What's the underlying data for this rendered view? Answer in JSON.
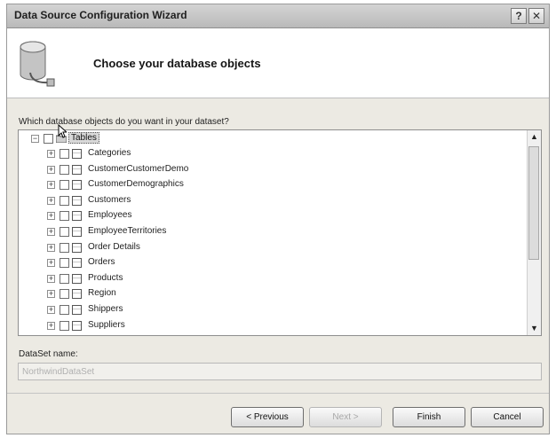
{
  "window": {
    "title": "Data Source Configuration Wizard",
    "help_label": "?",
    "close_label": "✕"
  },
  "header": {
    "title": "Choose your database objects",
    "icon": "database-icon"
  },
  "question": "Which database objects do you want in your dataset?",
  "tree": {
    "root": {
      "label": "Tables",
      "expander": "−",
      "checked": false
    },
    "items": [
      {
        "label": "Categories",
        "checked": false
      },
      {
        "label": "CustomerCustomerDemo",
        "checked": false
      },
      {
        "label": "CustomerDemographics",
        "checked": false
      },
      {
        "label": "Customers",
        "checked": false
      },
      {
        "label": "Employees",
        "checked": false
      },
      {
        "label": "EmployeeTerritories",
        "checked": false
      },
      {
        "label": "Order Details",
        "checked": false
      },
      {
        "label": "Orders",
        "checked": false
      },
      {
        "label": "Products",
        "checked": false
      },
      {
        "label": "Region",
        "checked": false
      },
      {
        "label": "Shippers",
        "checked": false
      },
      {
        "label": "Suppliers",
        "checked": false
      }
    ],
    "expander": "+"
  },
  "dataset": {
    "label": "DataSet name:",
    "value": "NorthwindDataSet"
  },
  "buttons": {
    "previous": "< Previous",
    "next": "Next >",
    "finish": "Finish",
    "cancel": "Cancel"
  }
}
